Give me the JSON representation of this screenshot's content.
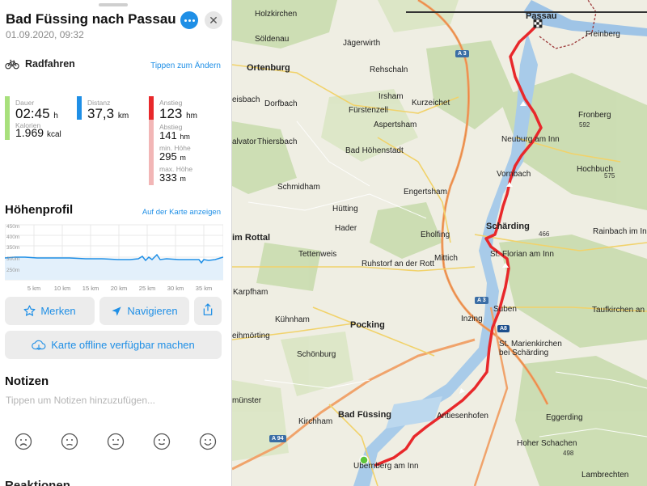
{
  "header": {
    "title": "Bad Füssing nach Passau",
    "subtitle": "01.09.2020, 09:32"
  },
  "mode": {
    "label": "Radfahren",
    "change_link": "Tippen zum Ändern",
    "icon": "bicycle-icon"
  },
  "stats": {
    "duration": {
      "label": "Dauer",
      "value": "02:45",
      "unit": "h"
    },
    "calories": {
      "label": "Kalorien",
      "value": "1.969",
      "unit": "kcal"
    },
    "distance": {
      "label": "Distanz",
      "value": "37,3",
      "unit": "km"
    },
    "ascent": {
      "label": "Anstieg",
      "value": "123",
      "unit": "hm"
    },
    "descent": {
      "label": "Abstieg",
      "value": "141",
      "unit": "hm"
    },
    "min_height": {
      "label": "min. Höhe",
      "value": "295",
      "unit": "m"
    },
    "max_height": {
      "label": "max. Höhe",
      "value": "333",
      "unit": "m"
    },
    "colors": {
      "duration": "#a8e07c",
      "distance": "#1f8fe6",
      "ascent": "#e8282b",
      "descent": "#f2b6b6"
    }
  },
  "elevation": {
    "title": "Höhenprofil",
    "link": "Auf der Karte anzeigen",
    "y_labels": [
      "450m",
      "400m",
      "350m",
      "300m",
      "250m"
    ],
    "x_labels": [
      "5 km",
      "10 km",
      "15 km",
      "20 km",
      "25 km",
      "30 km",
      "35 km"
    ]
  },
  "actions": {
    "bookmark": "Merken",
    "navigate": "Navigieren",
    "offline": "Karte offline verfügbar machen"
  },
  "notes": {
    "title": "Notizen",
    "placeholder": "Tippen um Notizen hinzuzufügen..."
  },
  "reactions": {
    "title": "Reaktionen"
  },
  "map": {
    "places": [
      "Holzkirchen",
      "Passau",
      "Söldenau",
      "Jägerwirth",
      "Freinberg",
      "Ortenburg",
      "Rehschaln",
      "eisbach",
      "Dorfbach",
      "Irsham",
      "Kurzeichet",
      "Fronberg",
      "Fürstenzell",
      "Aspertsham",
      "Neuburg am Inn",
      "alvator",
      "Thiersbach",
      "Bad Höhenstadt",
      "Hochbuch",
      "Vornbach",
      "Schmidham",
      "Engertsham",
      "Hütting",
      "Schärding",
      "Hader",
      "Eholfing",
      "im Rottal",
      "Rainbach im Innk",
      "Tettenweis",
      "Mittich",
      "St. Florian am Inn",
      "Ruhstorf an der Rott",
      "Karpfham",
      "Suben",
      "Taufkirchen an der",
      "Kühnham",
      "Pocking",
      "Inzing",
      "eihmörting",
      "St. Marienkirchen bei Schärding",
      "Schönburg",
      "münster",
      "Bad Füssing",
      "Antiesenhofen",
      "Kirchham",
      "Eggerding",
      "Hoher Schachen",
      "Lambrechten",
      "Ubernberg am Inn"
    ],
    "elevations": [
      "592",
      "575",
      "466",
      "498"
    ],
    "roads": [
      "A 3",
      "A 3",
      "A8",
      "A 94"
    ],
    "route_color": "#e8282b"
  }
}
